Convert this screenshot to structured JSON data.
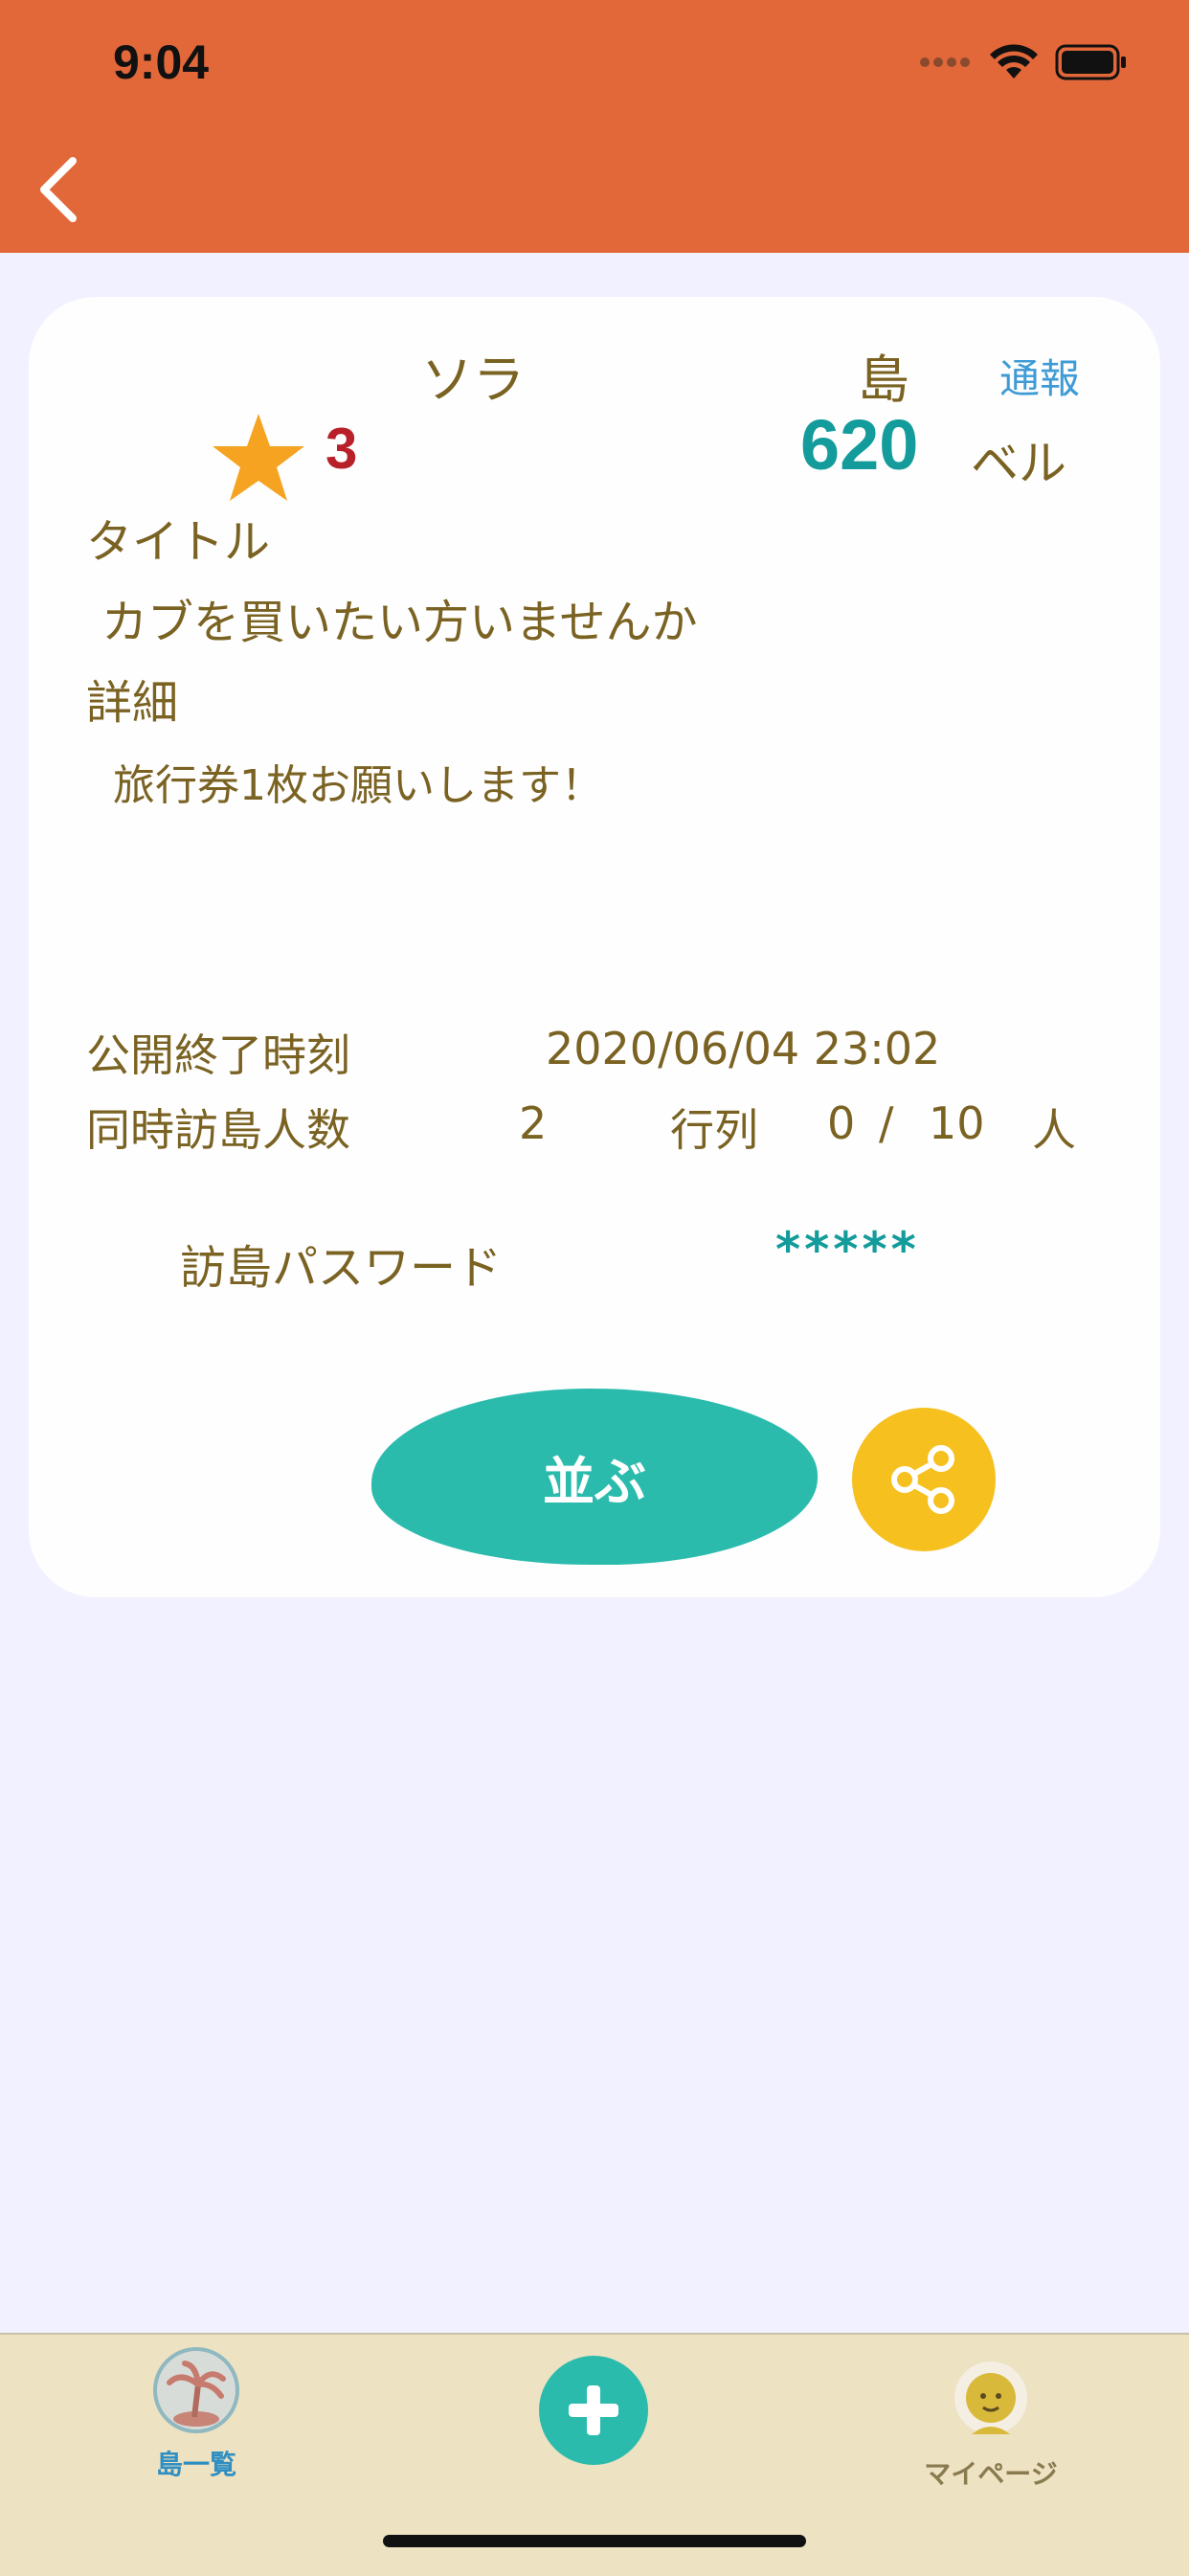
{
  "status_bar": {
    "time": "9:04"
  },
  "island": {
    "name": "ソラ",
    "label": "島",
    "report_label": "通報",
    "rating": "3",
    "price": "620",
    "price_unit": "ベル"
  },
  "post": {
    "title_label": "タイトル",
    "title": "カブを買いたい方いませんか",
    "detail_label": "詳細",
    "detail": "旅行券1枚お願いします！",
    "end_time_label": "公開終了時刻",
    "end_time": "2020/06/04 23:02",
    "visitors_label": "同時訪島人数",
    "visitors": "2",
    "queue_label": "行列",
    "queue_current": "0",
    "queue_separator": "/",
    "queue_max": "10",
    "queue_unit": "人",
    "password_label": "訪島パスワード",
    "password": "*****"
  },
  "actions": {
    "queue_button": "並ぶ"
  },
  "tab_bar": {
    "islands_label": "島一覧",
    "mypage_label": "マイページ"
  },
  "colors": {
    "header": "#e2683a",
    "accent_teal": "#2bbbad",
    "share_yellow": "#f6c01f",
    "text_brown": "#7a6222",
    "price_teal": "#149b9b",
    "rating_red": "#b8202a",
    "link_blue": "#3e9bd6",
    "tabbar_bg": "#ede2c2"
  },
  "icons": {
    "back": "chevron-left-icon",
    "star": "star-icon",
    "share": "share-icon",
    "islands_tab": "palm-tree-icon",
    "add_tab": "plus-icon",
    "mypage_tab": "avatar-icon"
  }
}
